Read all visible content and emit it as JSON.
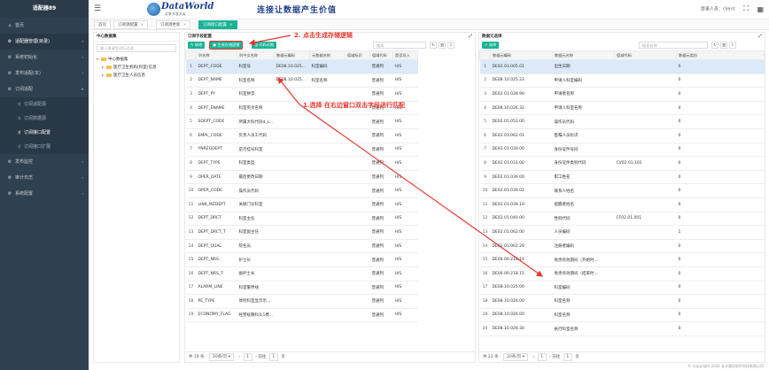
{
  "sidebar": {
    "brand": "适配器89",
    "items": [
      {
        "label": "首页",
        "icon": "home-icon",
        "glyph": "⌂"
      },
      {
        "label": "适配器管理(目录)",
        "icon": "gear-icon",
        "glyph": "⚙"
      },
      {
        "label": "系统初始化",
        "icon": "gear-icon",
        "glyph": "⚙"
      },
      {
        "label": "发布适配(本)",
        "icon": "gear-icon",
        "glyph": "⚙"
      },
      {
        "label": "订阅适配",
        "icon": "gear-icon",
        "glyph": "⚙"
      }
    ],
    "subitems": [
      {
        "label": "订阅适配源"
      },
      {
        "label": "订阅数据源"
      },
      {
        "label": "订阅接口配置"
      },
      {
        "label": "订阅接口扩展"
      }
    ],
    "items_after": [
      {
        "label": "发布监控",
        "icon": "gear-icon",
        "glyph": "⚙"
      },
      {
        "label": "审计日志",
        "icon": "gear-icon",
        "glyph": "⚙"
      },
      {
        "label": "系统配置",
        "icon": "gear-icon",
        "glyph": "⚙"
      }
    ]
  },
  "header": {
    "logo_main": "DataWorld",
    "logo_sub": "共享开放共赢",
    "slogan": "连接让数据产生价值",
    "user_label": "登录人员：client"
  },
  "tabs": [
    {
      "label": "首页"
    },
    {
      "label": "订阅源配置"
    },
    {
      "label": "订阅源更新"
    },
    {
      "label": "订阅接口配置"
    }
  ],
  "tree": {
    "title": "中心数据集",
    "search_placeholder": "输入关键字进行过滤",
    "root": "中心数据集",
    "children": [
      "医疗卫生机构(科室)信息",
      "医疗卫生人员信息"
    ]
  },
  "left_grid": {
    "title": "订阅字段配置",
    "buttons": {
      "edit": "修改",
      "generate": "生成存储逻辑",
      "code": "代码对照"
    },
    "search_placeholder": "搜索",
    "columns": [
      "",
      "列名称",
      "列中文名称",
      "数据元编码",
      "元数据名称",
      "值域标识",
      "值域代码",
      "适用单位",
      "是否导入"
    ],
    "rows": [
      [
        "1",
        "DEPT_CODE",
        "科室号",
        "DE08.10.025...",
        "科室编码",
        "",
        "普通列",
        "",
        "H/S"
      ],
      [
        "2",
        "DEPT_NAME",
        "科室名称",
        "DE08.10.025...",
        "科室名称",
        "",
        "普通列",
        "",
        "H/S"
      ],
      [
        "3",
        "DEPT_PY",
        "科室拼音",
        "",
        "",
        "",
        "普通列",
        "",
        "H/S"
      ],
      [
        "4",
        "DEPT_ENAME",
        "科室英文名称",
        "",
        "",
        "",
        "普通列",
        "",
        "H/S"
      ],
      [
        "5",
        "SDEPT_CODE",
        "所属大科代码d_s...",
        "",
        "",
        "",
        "普通列",
        "",
        "H/S"
      ],
      [
        "6",
        "EMPL_CODE",
        "负责人员工代码",
        "",
        "",
        "",
        "普通列",
        "",
        "H/S"
      ],
      [
        "7",
        "YNREGDEPT",
        "是否挂号科室",
        "",
        "",
        "",
        "普通列",
        "",
        "H/S"
      ],
      [
        "8",
        "DEPT_TYPE",
        "科室类型",
        "",
        "",
        "",
        "普通列",
        "",
        "H/S"
      ],
      [
        "9",
        "OPER_DATE",
        "最后更改日期",
        "",
        "",
        "",
        "普通列",
        "",
        "H/S"
      ],
      [
        "10",
        "OPER_CODE",
        "操作员代码",
        "",
        "",
        "",
        "普通列",
        "",
        "H/S"
      ],
      [
        "11",
        "LINK_MZDEPT",
        "关联门诊科室",
        "",
        "",
        "",
        "普通列",
        "",
        "H/S"
      ],
      [
        "12",
        "DEPT_DRCT",
        "科室主任",
        "",
        "",
        "",
        "普通列",
        "",
        "H/S"
      ],
      [
        "13",
        "DEPT_DRCT_T",
        "科室副主任",
        "",
        "",
        "",
        "普通列",
        "",
        "H/S"
      ],
      [
        "14",
        "DEPT_QUAL",
        "院名员",
        "",
        "",
        "",
        "普通列",
        "",
        "H/S"
      ],
      [
        "15",
        "DEPT_NRS",
        "护士长",
        "",
        "",
        "",
        "普通列",
        "",
        "H/S"
      ],
      [
        "16",
        "DEPT_NRS_T",
        "副护士长",
        "",
        "",
        "",
        "普通列",
        "",
        "H/S"
      ],
      [
        "17",
        "ALARM_LINE",
        "科室警界线",
        "",
        "",
        "",
        "普通列",
        "",
        "H/S"
      ],
      [
        "18",
        "PE_TYPE",
        "体检科室显示示...",
        "",
        "",
        "",
        "普通列",
        "",
        "H/S"
      ],
      [
        "19",
        "ECONOMY_FLAG",
        "经营核算科头1费...",
        "",
        "",
        "",
        "普通列",
        "",
        "H/S"
      ]
    ],
    "pager": {
      "total": "共 19 条",
      "size": "20条/页",
      "prev": "前往",
      "page": "1",
      "unit": "页"
    }
  },
  "right_grid": {
    "title": "数据元选择",
    "buttons": {
      "select": "选择"
    },
    "search_placeholder": "搜索名称",
    "columns": [
      "",
      "数据元编码",
      "数据元名称",
      "值域代码",
      "数据元类别"
    ],
    "rows": [
      [
        "1",
        "DE02.01.005.01",
        "出生日期",
        "",
        "0"
      ],
      [
        "2",
        "DE08.10.025.23",
        "申请人科室编码",
        "",
        "0"
      ],
      [
        "3",
        "DE02.01.039.90",
        "申请者名称",
        "",
        "0"
      ],
      [
        "4",
        "DE08.10.026.32",
        "申请人科室名称",
        "",
        "0"
      ],
      [
        "5",
        "DE02.01.052.00",
        "操作员代码",
        "",
        "0"
      ],
      [
        "6",
        "DE02.01.062.01",
        "医嘱人员标识",
        "",
        "0"
      ],
      [
        "7",
        "DE02.01.030.00",
        "身份证件号码",
        "",
        "0"
      ],
      [
        "8",
        "DE02.01.031.00",
        "身份证件类别代码",
        "CV02.01.101",
        "0"
      ],
      [
        "9",
        "DE02.01.039.00",
        "职工姓名",
        "",
        "0"
      ],
      [
        "10",
        "DE02.01.039.02",
        "联系人姓名",
        "",
        "0"
      ],
      [
        "11",
        "DE02.01.039.19",
        "提醒者姓名",
        "",
        "0"
      ],
      [
        "12",
        "DE02.01.040.00",
        "性别代码",
        "CF02.01.001",
        "0"
      ],
      [
        "13",
        "DE02.01.062.00",
        "人员编码",
        "",
        "1"
      ],
      [
        "14",
        "DE02.01.062.29",
        "注册者编码",
        "",
        "0"
      ],
      [
        "15",
        "DE06.00.218.14",
        "免责有效期间（开始时...",
        "",
        "0"
      ],
      [
        "16",
        "DE06.00.218.15",
        "免责有效期间（结束时...",
        "",
        "0"
      ],
      [
        "17",
        "DE08.10.025.00",
        "科室编码",
        "",
        "0"
      ],
      [
        "18",
        "DE08.10.026.00",
        "科室名称",
        "",
        "0"
      ],
      [
        "19",
        "DE08.10.026.00",
        "科室名称",
        "",
        "0"
      ],
      [
        "20",
        "DE08.10.026.30",
        "执行科室名称",
        "",
        "0"
      ]
    ],
    "pager": {
      "total": "共 22 条",
      "size": "20条/页",
      "prev": "前往",
      "page": "1",
      "unit": "页"
    }
  },
  "annotations": {
    "step1": "1.选择 在右边窗口双击字段进行匹配",
    "step2": "2. 点击生成存储逻辑"
  },
  "footer": "© Copyright 2016 长沙赛信软件科技有限公司",
  "colors": {
    "accent": "#1ab394",
    "annotation": "#e8372e",
    "sidebar": "#2f4050"
  }
}
